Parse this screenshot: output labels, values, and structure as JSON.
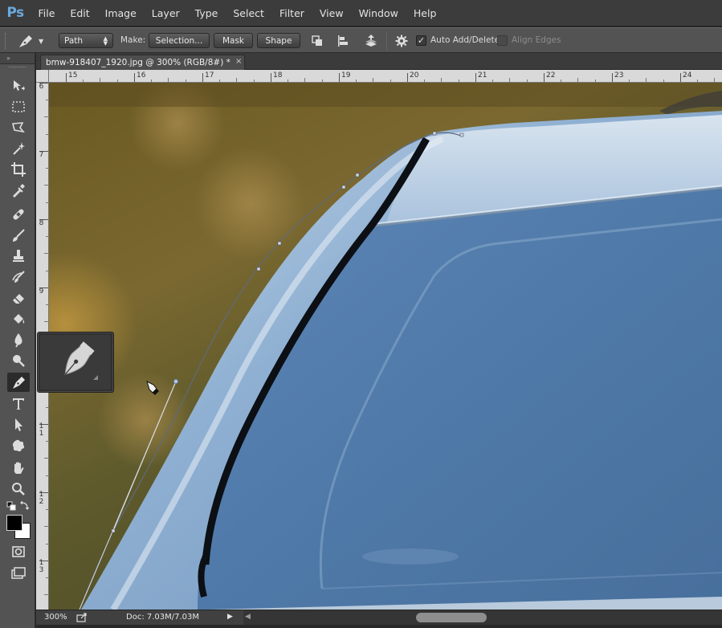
{
  "app": {
    "logo": "Ps"
  },
  "menu": [
    "File",
    "Edit",
    "Image",
    "Layer",
    "Type",
    "Select",
    "Filter",
    "View",
    "Window",
    "Help"
  ],
  "options_bar": {
    "mode_select": "Path",
    "make_label": "Make:",
    "selection_button": "Selection...",
    "mask_button": "Mask",
    "shape_button": "Shape",
    "auto_add_delete_label": "Auto Add/Delete",
    "auto_add_delete_checked": true,
    "align_edges_label": "Align Edges",
    "align_edges_checked": false
  },
  "toolbar": {
    "collapse_glyph": "»",
    "active_tool": "pen-tool"
  },
  "document": {
    "tab_title": "bmw-918407_1920.jpg @ 300% (RGB/8#) *",
    "close_glyph": "×"
  },
  "rulers": {
    "top": [
      "15",
      "16",
      "17",
      "18",
      "19",
      "20",
      "21",
      "22",
      "23",
      "24"
    ],
    "left": [
      "6",
      "7",
      "8",
      "9",
      "1 0",
      "1 1",
      "1 2",
      "1 3"
    ]
  },
  "status": {
    "zoom": "300%",
    "doc_info": "Doc: 7.03M/7.03M"
  },
  "colors": {
    "menu_bg": "#3c3c3c",
    "panel_bg": "#535353",
    "accent_logo": "#6aa9de",
    "path_anchor": "#cfd8ea"
  }
}
